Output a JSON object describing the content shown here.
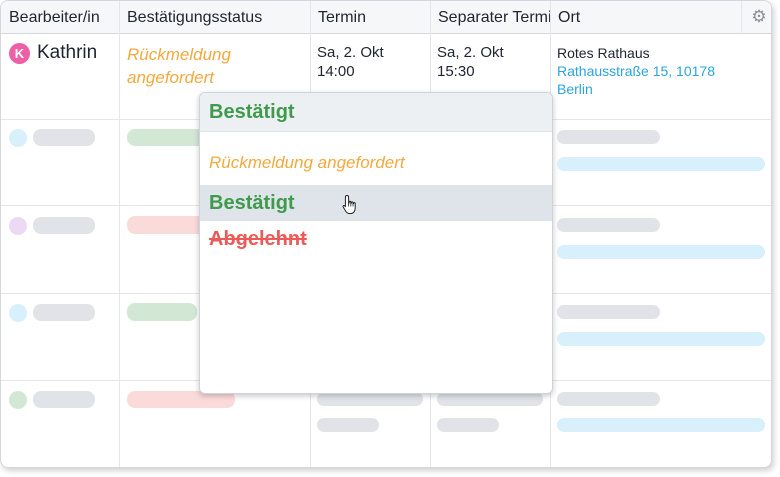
{
  "table": {
    "columns": [
      "Bearbeiter/in",
      "Bestätigungsstatus",
      "Termin",
      "Separater Termin",
      "Ort"
    ],
    "rows": [
      {
        "avatar_initial": "K",
        "assignee": "Kathrin",
        "status": "Rückmeldung angefordert",
        "termin_date": "Sa, 2. Okt",
        "termin_time": "14:00",
        "separater_date": "Sa, 2. Okt",
        "separater_time": "15:30",
        "location_name": "Rotes Rathaus",
        "location_address": "Rathausstraße 15, 10178 Berlin"
      }
    ]
  },
  "settings_icon": "gear-icon",
  "status_dropdown": {
    "current": "Bestätigt",
    "options": [
      "Rückmeldung angefordert",
      "Bestätigt",
      "Abgelehnt"
    ],
    "hovered": "Bestätigt"
  },
  "colors": {
    "pending": "#f3a93b",
    "confirmed": "#3f9a4c",
    "rejected": "#ec5a5a",
    "link": "#2aa5de",
    "avatar": "#ee5fa7"
  }
}
